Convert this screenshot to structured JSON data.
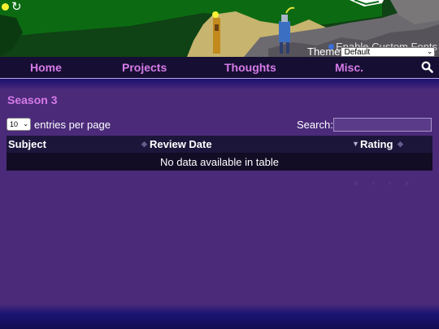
{
  "header": {
    "theme_label": "Theme",
    "theme_value": "Default",
    "custom_fonts_label": "Enable Custom Fonts",
    "icons": [
      "sun-icon",
      "refresh-icon"
    ]
  },
  "nav": {
    "items": [
      {
        "label": "Home"
      },
      {
        "label": "Projects"
      },
      {
        "label": "Thoughts"
      },
      {
        "label": "Misc."
      }
    ],
    "search_icon": "search-icon"
  },
  "main": {
    "section_title": "Season 3",
    "page_length_value": "10",
    "entries_label": "entries per page",
    "search_label": "Search:",
    "search_value": "",
    "table": {
      "columns": [
        {
          "label": "Subject"
        },
        {
          "label": "Review Date"
        },
        {
          "label": "Rating"
        }
      ],
      "empty_text": "No data available in table"
    },
    "pager_glyphs": [
      "«",
      "‹",
      "›",
      "»"
    ]
  },
  "colors": {
    "page_bg": "#4b2a7a",
    "nav_bg": "#160f33",
    "accent": "#d77be8",
    "table_header_bg": "#1d163b",
    "table_row_bg": "#120c24"
  }
}
